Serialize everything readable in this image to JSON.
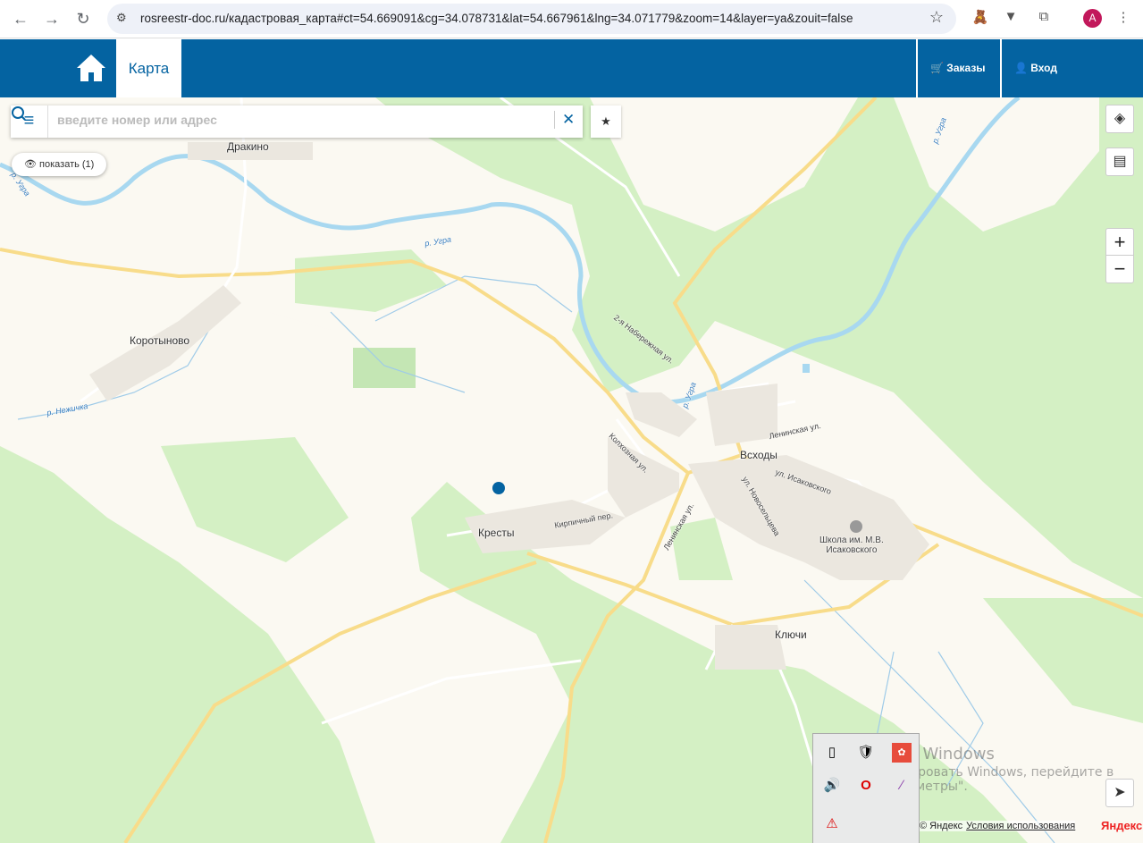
{
  "browser": {
    "url": "rosreestr-doc.ru/кадастровая_карта#ct=54.669091&cg=34.078731&lat=54.667961&lng=34.071779&zoom=14&layer=ya&zouit=false",
    "avatar": "A"
  },
  "header": {
    "tab": "Карта",
    "orders": "Заказы",
    "login": "Вход"
  },
  "search": {
    "placeholder": "введите номер или адрес",
    "value": ""
  },
  "show_button": "показать (1)",
  "zoom": {
    "in": "+",
    "out": "−"
  },
  "map_labels": {
    "drakino": "Дракино",
    "ugra1": "р. Угра",
    "ugra2": "р. Угра",
    "ugra3": "р. Угра",
    "ugra4": "р. Угра",
    "korotynovo": "Коротыново",
    "nezhichka": "р. Нежичка",
    "naberezh": "2-я Набережная ул.",
    "kolkhoz": "Колхозная ул.",
    "lenin1": "Ленинская ул.",
    "lenin2": "Ленинская ул.",
    "vskhody": "Всходы",
    "isakov": "ул. Исаковского",
    "novosel": "ул. Новосельцева",
    "school1": "Школа им. М.В.",
    "school2": "Исаковского",
    "kresty": "Кресты",
    "kirpich": "Кирпичный пер.",
    "klyuchi": "Ключи"
  },
  "watermark": {
    "title": "Активация Windows",
    "line1": "Чтобы активировать Windows, перейдите в",
    "line2": "раздел \"Параметры\"."
  },
  "attribution": {
    "copyright": "© Яндекс",
    "terms": "Условия использования",
    "logo": "Яндекс"
  },
  "colors": {
    "brand": "#0463a1",
    "map_green": "#d4f0c4",
    "map_land": "#fbf9f2",
    "road": "#f8dc8a",
    "river": "#a8d8f0"
  }
}
